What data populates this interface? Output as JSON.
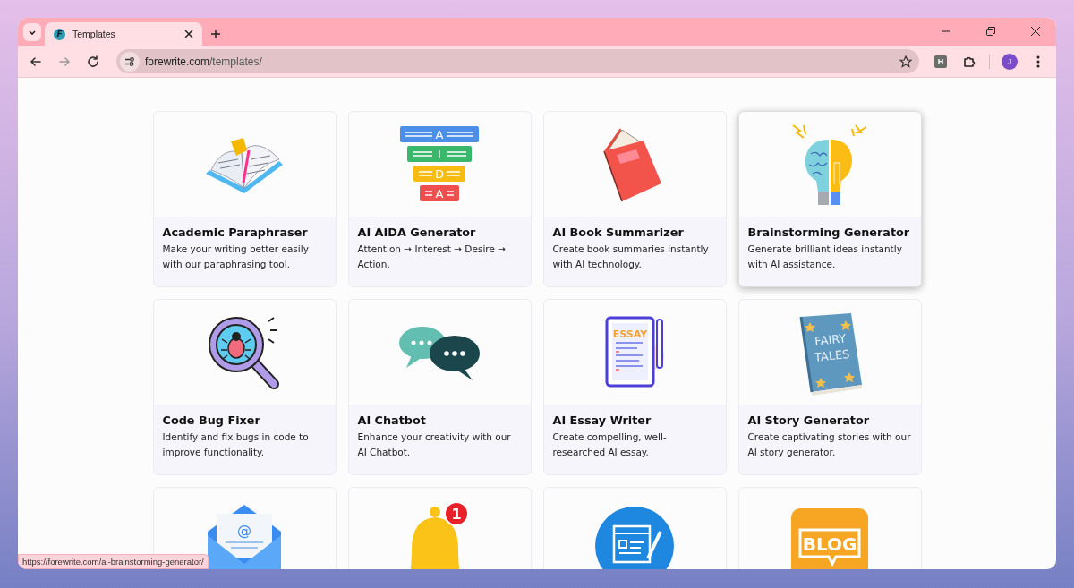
{
  "browser": {
    "tab": {
      "favicon_letter": "F",
      "title": "Templates"
    },
    "forward_disabled": true,
    "address": {
      "host": "forewrite.com",
      "path": "/templates/"
    },
    "extension_letter": "H",
    "profile_letter": "J"
  },
  "cards": [
    {
      "kind": "open-book",
      "title": "Academic Paraphraser",
      "description": "Make your writing better easily with our paraphrasing tool.",
      "hovered": false
    },
    {
      "kind": "funnel",
      "art_text": [
        "A",
        "I",
        "D",
        "A"
      ],
      "title": "AI AIDA Generator",
      "description": "Attention → Interest → Desire → Action.",
      "hovered": false
    },
    {
      "kind": "red-book",
      "title": "AI Book Summarizer",
      "description": "Create book summaries instantly with AI technology.",
      "hovered": false
    },
    {
      "kind": "brain-bulb",
      "title": "Brainstorming Generator",
      "description": "Generate brilliant ideas instantly with AI assistance.",
      "hovered": true
    },
    {
      "kind": "bug-magnifier",
      "title": "Code Bug Fixer",
      "description": "Identify and fix bugs in code to improve functionality.",
      "hovered": false
    },
    {
      "kind": "chat-bubbles",
      "title": "AI Chatbot",
      "description": "Enhance your creativity with our AI Chatbot.",
      "hovered": false
    },
    {
      "kind": "essay",
      "art_text": [
        "ESSAY"
      ],
      "title": "AI Essay Writer",
      "description": "Create compelling, well-researched AI essay.",
      "hovered": false
    },
    {
      "kind": "fairy-book",
      "art_text": [
        "FAIRY",
        "TALES"
      ],
      "title": "AI Story Generator",
      "description": "Create captivating stories with our AI story generator.",
      "hovered": false
    },
    {
      "kind": "envelope",
      "art_text": [
        "@"
      ],
      "hovered": false
    },
    {
      "kind": "bell",
      "art_text": [
        "1"
      ],
      "hovered": false
    },
    {
      "kind": "article-circle",
      "hovered": false
    },
    {
      "kind": "blog",
      "art_text": [
        "BLOG"
      ],
      "hovered": false
    }
  ],
  "status_url": "https://forewrite.com/ai-brainstorming-generator/"
}
